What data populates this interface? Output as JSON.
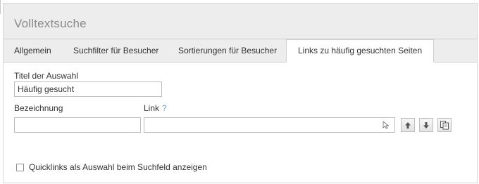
{
  "window": {
    "title": "Volltextsuche"
  },
  "tabs": [
    {
      "label": "Allgemein",
      "active": false
    },
    {
      "label": "Suchfilter für Besucher",
      "active": false
    },
    {
      "label": "Sortierungen für Besucher",
      "active": false
    },
    {
      "label": "Links zu häufig gesuchten Seiten",
      "active": true
    }
  ],
  "form": {
    "selection_title_label": "Titel der Auswahl",
    "selection_title_value": "Häufig gesucht",
    "designation_label": "Bezeichnung",
    "designation_value": "",
    "link_label": "Link",
    "link_help": "?",
    "link_value": "",
    "quicklinks_checkbox_label": "Quicklinks als Auswahl beim Suchfeld anzeigen",
    "quicklinks_checked": false
  },
  "icons": {
    "link_picker": "cursor-arrow-icon",
    "move_up": "arrow-up-icon",
    "move_down": "arrow-down-icon",
    "copy": "copy-icon"
  },
  "colors": {
    "header_bg": "#ededed",
    "border": "#cfcfcf",
    "help_accent": "#5aa0d6"
  }
}
